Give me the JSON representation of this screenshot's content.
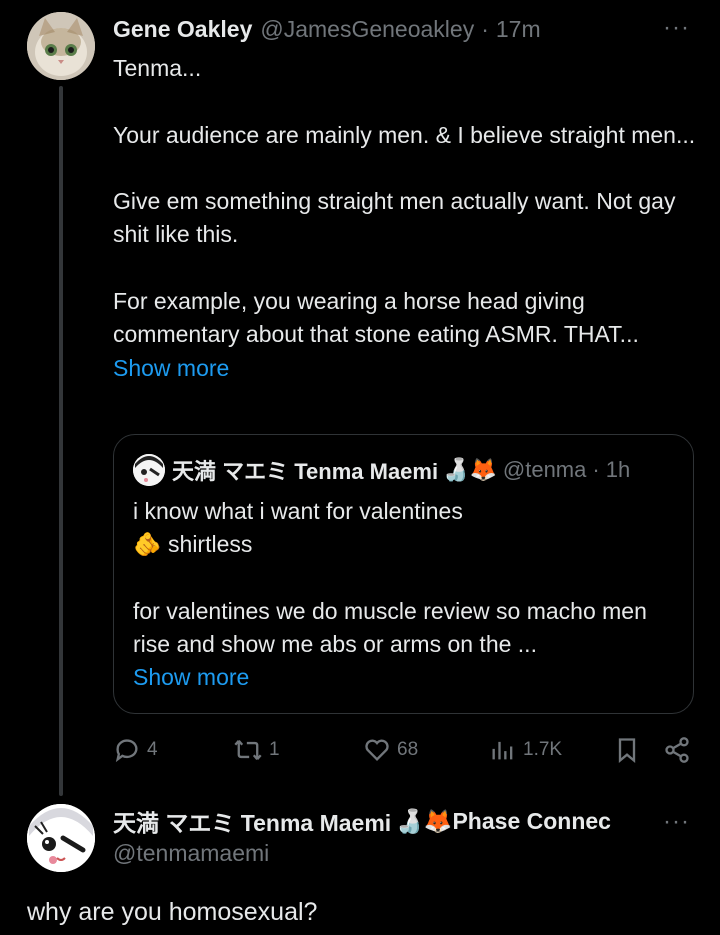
{
  "post": {
    "author_name": "Gene Oakley",
    "author_handle": "@JamesGeneoakley",
    "separator": "·",
    "time": "17m",
    "more_label": "···",
    "paragraphs": [
      "Tenma...",
      "Your audience are mainly men. & I believe straight men...",
      "Give em something straight men actually want. Not gay shit like this.",
      "For example, you wearing a horse head giving commentary about that stone eating ASMR. THAT..."
    ],
    "show_more": "Show more"
  },
  "quote": {
    "author_name": "天満 マエミ Tenma Maemi",
    "badges": "🍶🦊",
    "author_handle": "@tenma",
    "separator": "·",
    "time": "1h",
    "line1": "i know what i want for valentines",
    "line2_emoji": "🫵",
    "line2": "shirtless",
    "para2": "for valentines we do muscle review  so macho men rise and show me abs or arms on the ...",
    "show_more": "Show more"
  },
  "actions": {
    "replies": "4",
    "reposts": "1",
    "likes": "68",
    "views": "1.7K"
  },
  "reply": {
    "author_name": "天満 マエミ Tenma Maemi",
    "badges": "🍶🦊",
    "author_suffix": "Phase Connec",
    "author_handle": "@tenmamaemi",
    "more_label": "···",
    "text": "why are you homosexual?"
  },
  "colors": {
    "background": "#000000",
    "text": "#e7e9ea",
    "muted": "#71767b",
    "link": "#1d9bf0",
    "border": "#2f3336"
  }
}
